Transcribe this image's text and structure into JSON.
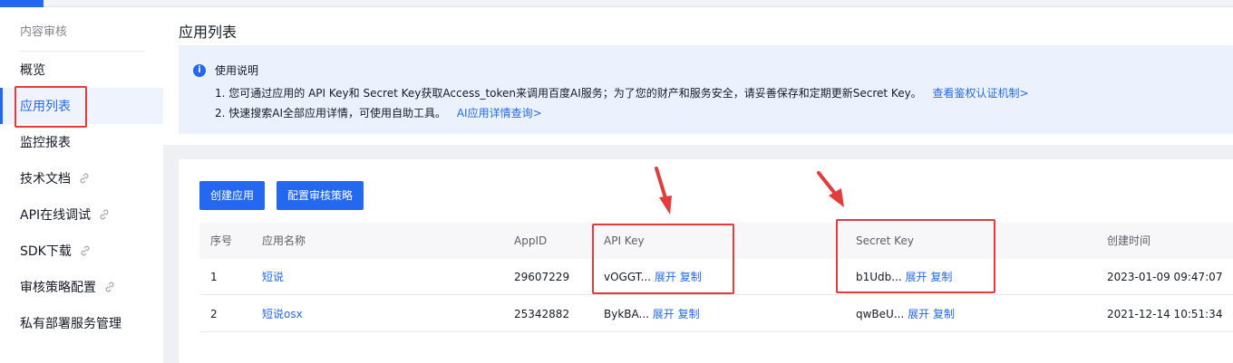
{
  "sidebar": {
    "section_title": "内容审核",
    "items": [
      {
        "label": "概览"
      },
      {
        "label": "应用列表"
      },
      {
        "label": "监控报表"
      },
      {
        "label": "技术文档"
      },
      {
        "label": "API在线调试"
      },
      {
        "label": "SDK下载"
      },
      {
        "label": "审核策略配置"
      },
      {
        "label": "私有部署服务管理"
      }
    ]
  },
  "main": {
    "page_title": "应用列表",
    "notice": {
      "title": "使用说明",
      "line1": "1. 您可通过应用的 API Key和 Secret Key获取Access_token来调用百度AI服务；为了您的财产和服务安全，请妥善保存和定期更新Secret Key。",
      "line1_link": "查看鉴权认证机制>",
      "line2": "2. 快速搜索AI全部应用详情，可使用自助工具。",
      "line2_link": "AI应用详情查询>"
    },
    "buttons": {
      "create": "创建应用",
      "config": "配置审核策略"
    },
    "table": {
      "headers": {
        "index": "序号",
        "name": "应用名称",
        "appid": "AppID",
        "apikey": "API Key",
        "secretkey": "Secret Key",
        "created": "创建时间"
      },
      "rows": [
        {
          "index": "1",
          "name": "短说",
          "appid": "29607229",
          "apikey": "vOGGT...",
          "secretkey": "b1Udb...",
          "created": "2023-01-09 09:47:07"
        },
        {
          "index": "2",
          "name": "短说osx",
          "appid": "25342882",
          "apikey": "BykBA...",
          "secretkey": "qwBeU...",
          "created": "2021-12-14 10:51:34"
        }
      ],
      "expand_label": "展开",
      "copy_label": "复制"
    }
  },
  "colors": {
    "accent": "#2468f2",
    "annotation": "#e23c3c"
  }
}
